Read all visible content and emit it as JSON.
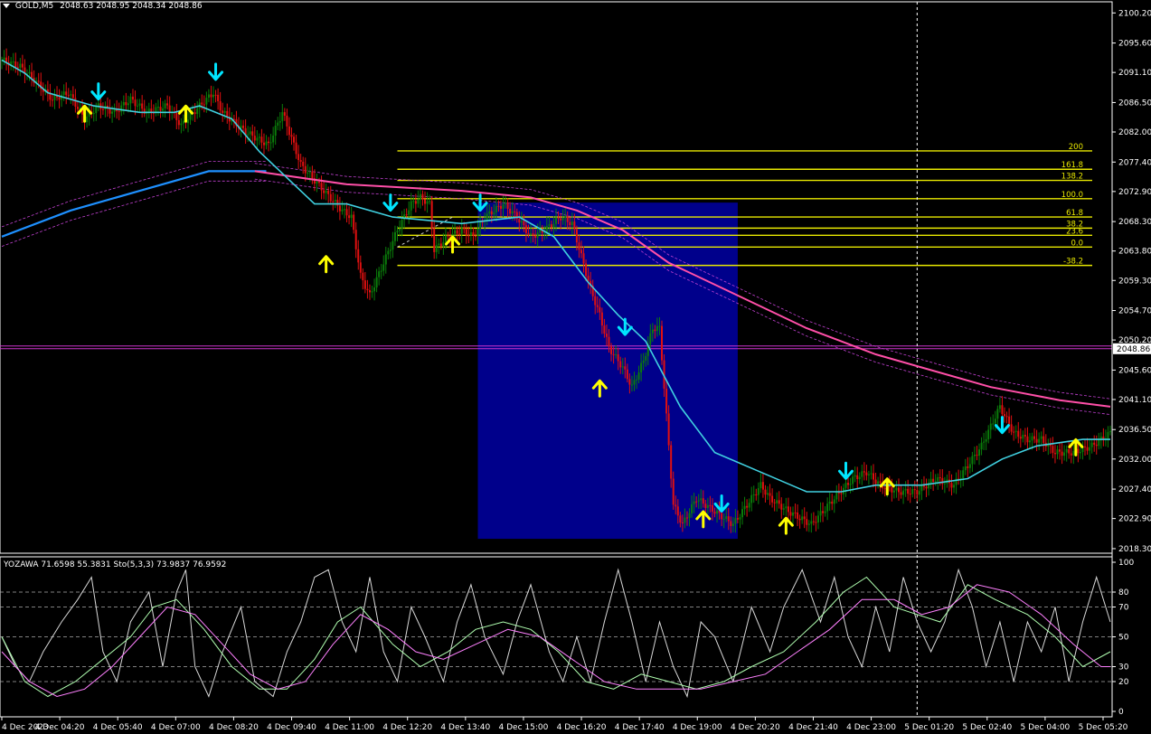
{
  "header": {
    "symbol": "GOLD,M5",
    "ohlc": "2048.63 2048.95 2048.34 2048.86",
    "dropdown_icon": "triangle-down-icon"
  },
  "indicator_header": "YOZAWA 71.6598 55.3831  Sto(5,3,3) 73.9837 76.9592",
  "current_price_label": "2048.86",
  "colors": {
    "background": "#000000",
    "bull": "#0a7d0a",
    "bear": "#e01010",
    "fast_ma": "#40d0e0",
    "slow_ma": "#1e90ff",
    "pink_ma": "#ff4fa8",
    "fib": "#e8e800",
    "zone": "#00008b",
    "price_line": "#cc33cc",
    "arrow_up": "#ffff00",
    "arrow_down": "#00e5ff",
    "osc_white": "#d8d8d8",
    "osc_green": "#b0ffb0",
    "osc_magenta": "#ff80ff"
  },
  "chart_data": {
    "type": "candlestick",
    "price_axis_ticks": [
      "2100.20",
      "2095.60",
      "2091.10",
      "2086.50",
      "2082.00",
      "2077.40",
      "2072.90",
      "2068.30",
      "2063.80",
      "2059.30",
      "2054.70",
      "2050.20",
      "2045.60",
      "2041.10",
      "2036.50",
      "2032.00",
      "2027.40",
      "2022.90",
      "2018.30"
    ],
    "ylim": [
      2017.6,
      2101.9
    ],
    "time_axis_ticks": [
      "4 Dec 2023",
      "4 Dec 04:20",
      "4 Dec 05:40",
      "4 Dec 07:00",
      "4 Dec 08:20",
      "4 Dec 09:40",
      "4 Dec 11:00",
      "4 Dec 12:20",
      "4 Dec 13:40",
      "4 Dec 15:00",
      "4 Dec 16:20",
      "4 Dec 17:40",
      "4 Dec 19:00",
      "4 Dec 20:20",
      "4 Dec 21:40",
      "4 Dec 23:00",
      "5 Dec 01:20",
      "5 Dec 02:40",
      "5 Dec 04:00",
      "5 Dec 05:20"
    ],
    "close_path": [
      [
        0,
        2093
      ],
      [
        8,
        2092
      ],
      [
        14,
        2090
      ],
      [
        22,
        2087
      ],
      [
        29,
        2088
      ],
      [
        36,
        2084
      ],
      [
        42,
        2086
      ],
      [
        49,
        2085
      ],
      [
        56,
        2087
      ],
      [
        63,
        2085
      ],
      [
        72,
        2086
      ],
      [
        78,
        2083
      ],
      [
        86,
        2086
      ],
      [
        92,
        2088
      ],
      [
        96,
        2085
      ],
      [
        106,
        2082
      ],
      [
        116,
        2080
      ],
      [
        122,
        2085
      ],
      [
        130,
        2077
      ],
      [
        140,
        2073
      ],
      [
        148,
        2070
      ],
      [
        152,
        2069
      ],
      [
        156,
        2060
      ],
      [
        160,
        2057
      ],
      [
        166,
        2062
      ],
      [
        172,
        2067
      ],
      [
        178,
        2071
      ],
      [
        182,
        2072
      ],
      [
        186,
        2071
      ],
      [
        188,
        2064
      ],
      [
        194,
        2066
      ],
      [
        200,
        2067
      ],
      [
        205,
        2066
      ],
      [
        210,
        2069
      ],
      [
        218,
        2071
      ],
      [
        224,
        2069
      ],
      [
        230,
        2066
      ],
      [
        236,
        2067
      ],
      [
        243,
        2069
      ],
      [
        248,
        2068
      ],
      [
        252,
        2063
      ],
      [
        256,
        2058
      ],
      [
        260,
        2054
      ],
      [
        264,
        2049
      ],
      [
        270,
        2046
      ],
      [
        274,
        2043
      ],
      [
        279,
        2047
      ],
      [
        283,
        2052
      ],
      [
        286,
        2052
      ],
      [
        288,
        2043
      ],
      [
        290,
        2034
      ],
      [
        292,
        2025
      ],
      [
        296,
        2022
      ],
      [
        302,
        2026
      ],
      [
        310,
        2024
      ],
      [
        318,
        2022
      ],
      [
        326,
        2026
      ],
      [
        330,
        2028
      ],
      [
        334,
        2026
      ],
      [
        342,
        2024
      ],
      [
        352,
        2022
      ],
      [
        362,
        2026
      ],
      [
        370,
        2029
      ],
      [
        376,
        2030
      ],
      [
        382,
        2028
      ],
      [
        390,
        2027
      ],
      [
        398,
        2027
      ],
      [
        406,
        2029
      ],
      [
        414,
        2028
      ],
      [
        420,
        2031
      ],
      [
        426,
        2034
      ],
      [
        430,
        2037
      ],
      [
        434,
        2040
      ],
      [
        440,
        2036
      ],
      [
        446,
        2035
      ],
      [
        452,
        2035
      ],
      [
        458,
        2033
      ],
      [
        466,
        2033
      ],
      [
        474,
        2034
      ],
      [
        482,
        2036
      ]
    ],
    "candle_colors": "bear when close falls, bull when close rises",
    "fast_ma": [
      [
        0,
        2093
      ],
      [
        10,
        2091
      ],
      [
        20,
        2088
      ],
      [
        40,
        2086
      ],
      [
        60,
        2085
      ],
      [
        75,
        2085
      ],
      [
        86,
        2086
      ],
      [
        100,
        2084
      ],
      [
        112,
        2079
      ],
      [
        124,
        2075
      ],
      [
        136,
        2071
      ],
      [
        150,
        2071
      ],
      [
        170,
        2069
      ],
      [
        200,
        2068
      ],
      [
        225,
        2069
      ],
      [
        240,
        2066
      ],
      [
        255,
        2059
      ],
      [
        268,
        2054
      ],
      [
        280,
        2050
      ],
      [
        295,
        2040
      ],
      [
        310,
        2033
      ],
      [
        330,
        2030
      ],
      [
        350,
        2027
      ],
      [
        365,
        2027
      ],
      [
        380,
        2028
      ],
      [
        400,
        2028
      ],
      [
        420,
        2029
      ],
      [
        435,
        2032
      ],
      [
        450,
        2034
      ],
      [
        470,
        2035
      ],
      [
        482,
        2035
      ]
    ],
    "slow_ma": [
      [
        0,
        2066
      ],
      [
        30,
        2070
      ],
      [
        60,
        2073
      ],
      [
        90,
        2076
      ],
      [
        110,
        2076
      ],
      [
        115,
        2076
      ]
    ],
    "pink_ma": [
      [
        110,
        2076
      ],
      [
        150,
        2074
      ],
      [
        200,
        2073
      ],
      [
        230,
        2072
      ],
      [
        250,
        2070
      ],
      [
        270,
        2067
      ],
      [
        290,
        2062
      ],
      [
        320,
        2057
      ],
      [
        350,
        2052
      ],
      [
        380,
        2048
      ],
      [
        400,
        2046
      ],
      [
        430,
        2043
      ],
      [
        460,
        2041
      ],
      [
        482,
        2040
      ]
    ],
    "fib_levels": [
      {
        "label": "200",
        "price": 2079.1
      },
      {
        "label": "161.8",
        "price": 2076.3
      },
      {
        "label": "138.2",
        "price": 2074.6
      },
      {
        "label": "100.0",
        "price": 2071.8
      },
      {
        "label": "61.8",
        "price": 2069.0
      },
      {
        "label": "38.2",
        "price": 2067.3
      },
      {
        "label": "23.6",
        "price": 2066.2
      },
      {
        "label": "0.0",
        "price": 2064.4
      },
      {
        "label": "-38.2",
        "price": 2061.6
      }
    ],
    "fib_x_range": [
      172,
      482
    ],
    "zone": {
      "x_range": [
        207,
        320
      ],
      "price_range": [
        2019.8,
        2071.2
      ]
    },
    "current_price": 2048.86,
    "vertical_marker_bar": 398,
    "arrows_up": [
      [
        36,
        2085
      ],
      [
        80,
        2085
      ],
      [
        141,
        2062
      ],
      [
        196,
        2065
      ],
      [
        260,
        2043
      ],
      [
        305,
        2023
      ],
      [
        341,
        2022
      ],
      [
        385,
        2028
      ],
      [
        467,
        2034
      ]
    ],
    "arrows_down": [
      [
        42,
        2088
      ],
      [
        93,
        2091
      ],
      [
        169,
        2071
      ],
      [
        208,
        2071
      ],
      [
        271,
        2052
      ],
      [
        313,
        2025
      ],
      [
        367,
        2030
      ],
      [
        435,
        2037
      ]
    ],
    "oscillator": {
      "ylim": [
        0,
        100
      ],
      "tick_labels": [
        "100",
        "80",
        "70",
        "50",
        "30",
        "20",
        "0"
      ],
      "tick_values": [
        100,
        80,
        70,
        50,
        30,
        20,
        0
      ],
      "dashed_levels": [
        80,
        70,
        50,
        30,
        20
      ],
      "white": [
        [
          0,
          50
        ],
        [
          6,
          30
        ],
        [
          12,
          20
        ],
        [
          18,
          40
        ],
        [
          26,
          60
        ],
        [
          33,
          75
        ],
        [
          39,
          90
        ],
        [
          44,
          40
        ],
        [
          50,
          20
        ],
        [
          56,
          60
        ],
        [
          64,
          80
        ],
        [
          70,
          30
        ],
        [
          76,
          80
        ],
        [
          80,
          95
        ],
        [
          84,
          30
        ],
        [
          90,
          10
        ],
        [
          96,
          40
        ],
        [
          104,
          70
        ],
        [
          110,
          20
        ],
        [
          118,
          10
        ],
        [
          124,
          40
        ],
        [
          130,
          60
        ],
        [
          136,
          90
        ],
        [
          142,
          95
        ],
        [
          148,
          60
        ],
        [
          154,
          40
        ],
        [
          160,
          90
        ],
        [
          166,
          40
        ],
        [
          172,
          20
        ],
        [
          178,
          70
        ],
        [
          184,
          50
        ],
        [
          192,
          20
        ],
        [
          198,
          60
        ],
        [
          204,
          85
        ],
        [
          210,
          50
        ],
        [
          218,
          25
        ],
        [
          224,
          60
        ],
        [
          230,
          85
        ],
        [
          238,
          40
        ],
        [
          244,
          20
        ],
        [
          250,
          50
        ],
        [
          256,
          20
        ],
        [
          262,
          60
        ],
        [
          268,
          95
        ],
        [
          274,
          60
        ],
        [
          280,
          20
        ],
        [
          286,
          60
        ],
        [
          292,
          30
        ],
        [
          298,
          10
        ],
        [
          304,
          60
        ],
        [
          310,
          50
        ],
        [
          318,
          20
        ],
        [
          326,
          70
        ],
        [
          334,
          40
        ],
        [
          340,
          70
        ],
        [
          348,
          95
        ],
        [
          356,
          60
        ],
        [
          362,
          90
        ],
        [
          368,
          50
        ],
        [
          374,
          30
        ],
        [
          380,
          70
        ],
        [
          386,
          40
        ],
        [
          392,
          90
        ],
        [
          398,
          60
        ],
        [
          404,
          40
        ],
        [
          410,
          60
        ],
        [
          416,
          95
        ],
        [
          422,
          70
        ],
        [
          428,
          30
        ],
        [
          434,
          60
        ],
        [
          440,
          20
        ],
        [
          446,
          60
        ],
        [
          452,
          40
        ],
        [
          458,
          70
        ],
        [
          464,
          20
        ],
        [
          470,
          60
        ],
        [
          476,
          90
        ],
        [
          482,
          60
        ]
      ],
      "green": [
        [
          0,
          50
        ],
        [
          10,
          20
        ],
        [
          20,
          10
        ],
        [
          32,
          20
        ],
        [
          44,
          35
        ],
        [
          56,
          50
        ],
        [
          66,
          70
        ],
        [
          76,
          75
        ],
        [
          88,
          55
        ],
        [
          100,
          30
        ],
        [
          112,
          15
        ],
        [
          124,
          15
        ],
        [
          136,
          35
        ],
        [
          146,
          60
        ],
        [
          156,
          70
        ],
        [
          170,
          45
        ],
        [
          182,
          30
        ],
        [
          194,
          40
        ],
        [
          206,
          55
        ],
        [
          218,
          60
        ],
        [
          230,
          55
        ],
        [
          242,
          40
        ],
        [
          254,
          20
        ],
        [
          266,
          15
        ],
        [
          278,
          25
        ],
        [
          290,
          20
        ],
        [
          302,
          15
        ],
        [
          314,
          20
        ],
        [
          326,
          30
        ],
        [
          340,
          40
        ],
        [
          354,
          60
        ],
        [
          366,
          80
        ],
        [
          376,
          90
        ],
        [
          388,
          70
        ],
        [
          398,
          65
        ],
        [
          408,
          60
        ],
        [
          420,
          85
        ],
        [
          432,
          75
        ],
        [
          446,
          65
        ],
        [
          458,
          50
        ],
        [
          470,
          30
        ],
        [
          482,
          40
        ]
      ],
      "magenta": [
        [
          0,
          40
        ],
        [
          12,
          20
        ],
        [
          24,
          10
        ],
        [
          36,
          15
        ],
        [
          48,
          30
        ],
        [
          60,
          50
        ],
        [
          72,
          70
        ],
        [
          84,
          65
        ],
        [
          96,
          45
        ],
        [
          108,
          25
        ],
        [
          120,
          15
        ],
        [
          132,
          20
        ],
        [
          144,
          45
        ],
        [
          156,
          65
        ],
        [
          168,
          55
        ],
        [
          180,
          40
        ],
        [
          192,
          35
        ],
        [
          206,
          45
        ],
        [
          220,
          55
        ],
        [
          234,
          50
        ],
        [
          248,
          35
        ],
        [
          262,
          20
        ],
        [
          276,
          15
        ],
        [
          290,
          15
        ],
        [
          304,
          15
        ],
        [
          318,
          20
        ],
        [
          332,
          25
        ],
        [
          346,
          40
        ],
        [
          360,
          55
        ],
        [
          374,
          75
        ],
        [
          388,
          75
        ],
        [
          400,
          65
        ],
        [
          412,
          70
        ],
        [
          424,
          85
        ],
        [
          438,
          80
        ],
        [
          452,
          65
        ],
        [
          466,
          45
        ],
        [
          478,
          30
        ],
        [
          482,
          30
        ]
      ]
    }
  }
}
